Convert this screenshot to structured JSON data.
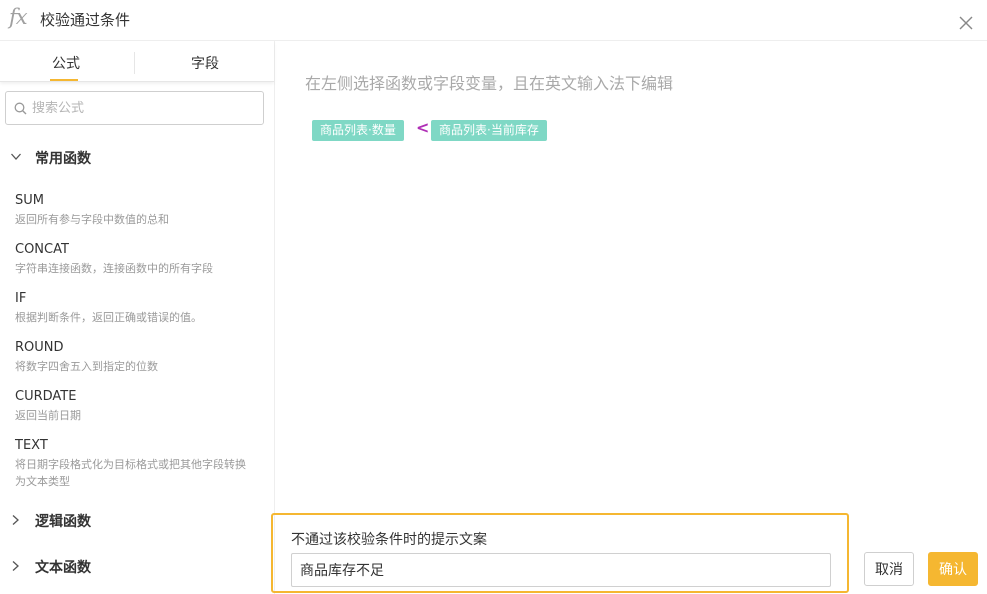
{
  "header": {
    "icon": "fx-icon",
    "title": "校验通过条件",
    "close_icon": "close-icon"
  },
  "sidebar": {
    "tabs": [
      {
        "label": "公式",
        "active": true
      },
      {
        "label": "字段",
        "active": false
      }
    ],
    "search": {
      "placeholder": "搜索公式",
      "value": ""
    },
    "groups": [
      {
        "label": "常用函数",
        "expanded": true,
        "functions": [
          {
            "name": "SUM",
            "desc": "返回所有参与字段中数值的总和"
          },
          {
            "name": "CONCAT",
            "desc": "字符串连接函数，连接函数中的所有字段"
          },
          {
            "name": "IF",
            "desc": "根据判断条件，返回正确或错误的值。"
          },
          {
            "name": "ROUND",
            "desc": "将数字四舍五入到指定的位数"
          },
          {
            "name": "CURDATE",
            "desc": "返回当前日期"
          },
          {
            "name": "TEXT",
            "desc": "将日期字段格式化为目标格式或把其他字段转换为文本类型"
          }
        ]
      },
      {
        "label": "逻辑函数",
        "expanded": false
      },
      {
        "label": "文本函数",
        "expanded": false
      }
    ]
  },
  "editor": {
    "hint": "在左侧选择函数或字段变量，且在英文输入法下编辑",
    "formula": {
      "left_field": "商品列表·数量",
      "operator": "<",
      "right_field": "商品列表·当前库存"
    }
  },
  "message": {
    "label": "不通过该校验条件时的提示文案",
    "value": "商品库存不足"
  },
  "buttons": {
    "cancel": "取消",
    "confirm": "确认"
  },
  "colors": {
    "accent": "#f5b731",
    "field_chip": "#7fd8c5",
    "operator": "#b02fb6",
    "hint_text": "#a9a9a9"
  }
}
